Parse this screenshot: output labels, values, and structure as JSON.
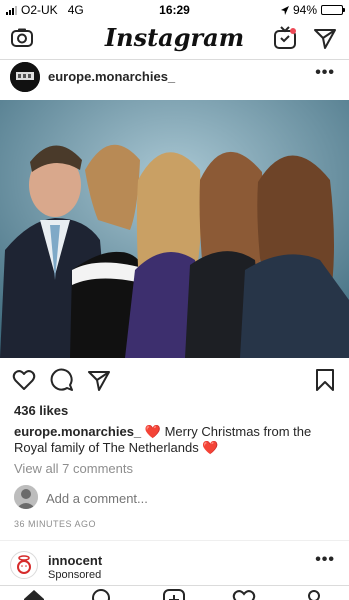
{
  "status_bar": {
    "carrier": "O2-UK",
    "network": "4G",
    "time": "16:29",
    "battery": "94%",
    "battery_level": 0.94,
    "battery_color": "#4cd964"
  },
  "top_bar": {
    "logo": "Instagram",
    "icons": [
      "camera-icon",
      "igtv-icon",
      "direct-message-icon"
    ]
  },
  "post": {
    "username": "europe.monarchies_",
    "more_label": "•••",
    "actions": [
      "like-icon",
      "comment-icon",
      "share-icon",
      "bookmark-icon"
    ],
    "likes": "436 likes",
    "caption_user": "europe.monarchies_",
    "caption_heart1": "❤️",
    "caption_text": "Merry Christmas from the Royal family of The Netherlands",
    "caption_heart2": "❤️",
    "view_comments": "View all 7 comments",
    "add_comment_placeholder": "Add a comment...",
    "time_ago": "36 MINUTES AGO"
  },
  "next_post": {
    "username": "innocent",
    "sponsored": "Sponsored",
    "more_label": "•••"
  },
  "tab_bar": {
    "tabs": [
      "home-icon",
      "search-icon",
      "new-post-icon",
      "activity-icon",
      "profile-icon"
    ]
  },
  "colors": {
    "text": "#262626",
    "secondary": "#8e8e8e",
    "divider": "#dbdbdb",
    "like_red": "#e0245e"
  }
}
